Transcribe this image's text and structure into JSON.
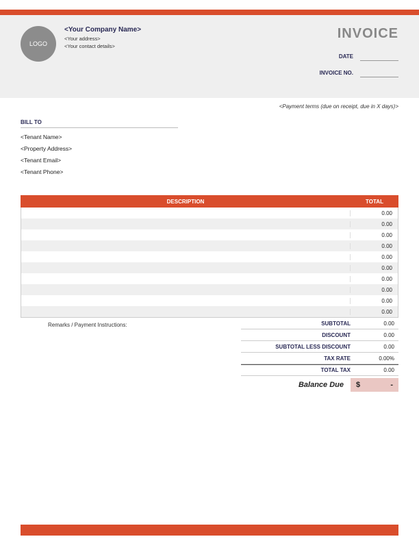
{
  "logo_text": "LOGO",
  "company": {
    "name": "<Your Company Name>",
    "address": "<Your address>",
    "contact": "<Your contact details>"
  },
  "invoice_title": "INVOICE",
  "meta": {
    "date_label": "DATE",
    "date_value": "",
    "invoice_no_label": "INVOICE NO.",
    "invoice_no_value": ""
  },
  "payment_terms": "<Payment terms (due on receipt, due in X days)>",
  "bill_to": {
    "label": "BILL TO",
    "tenant_name": "<Tenant Name>",
    "property_address": "<Property Address>",
    "tenant_email": "<Tenant Email>",
    "tenant_phone": "<Tenant Phone>"
  },
  "columns": {
    "description": "DESCRIPTION",
    "total": "TOTAL"
  },
  "items": [
    {
      "description": "",
      "total": "0.00"
    },
    {
      "description": "",
      "total": "0.00"
    },
    {
      "description": "",
      "total": "0.00"
    },
    {
      "description": "",
      "total": "0.00"
    },
    {
      "description": "",
      "total": "0.00"
    },
    {
      "description": "",
      "total": "0.00"
    },
    {
      "description": "",
      "total": "0.00"
    },
    {
      "description": "",
      "total": "0.00"
    },
    {
      "description": "",
      "total": "0.00"
    },
    {
      "description": "",
      "total": "0.00"
    }
  ],
  "remarks_label": "Remarks / Payment Instructions:",
  "totals": {
    "subtotal_label": "SUBTOTAL",
    "subtotal_value": "0.00",
    "discount_label": "DISCOUNT",
    "discount_value": "0.00",
    "less_discount_label": "SUBTOTAL LESS DISCOUNT",
    "less_discount_value": "0.00",
    "tax_rate_label": "TAX RATE",
    "tax_rate_value": "0.00%",
    "total_tax_label": "TOTAL TAX",
    "total_tax_value": "0.00"
  },
  "balance": {
    "label": "Balance Due",
    "currency": "$",
    "value": "-"
  }
}
